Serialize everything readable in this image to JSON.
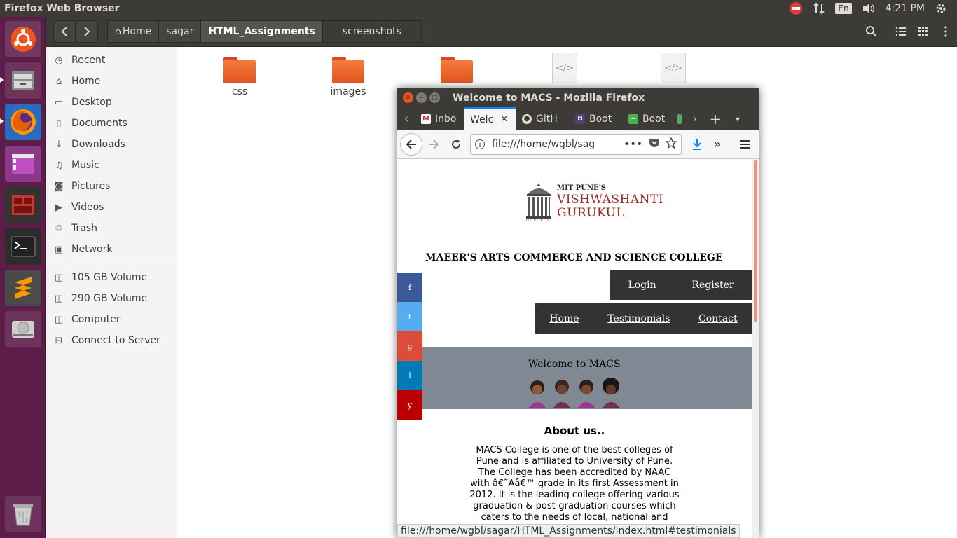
{
  "topbar": {
    "title": "Firefox Web Browser",
    "lang": "En",
    "time": "4:21 PM"
  },
  "launcher": {
    "items": [
      "ubuntu-dash",
      "files",
      "firefox",
      "image-viewer",
      "system-monitor",
      "terminal",
      "sublime-text",
      "disks",
      "trash"
    ]
  },
  "nautilus": {
    "breadcrumbs": [
      "Home",
      "sagar",
      "HTML_Assignments",
      "screenshots"
    ],
    "active_crumb": "HTML_Assignments",
    "sidebar": {
      "items": [
        {
          "label": "Recent",
          "icon": "clock-icon"
        },
        {
          "label": "Home",
          "icon": "home-icon"
        },
        {
          "label": "Desktop",
          "icon": "desktop-icon"
        },
        {
          "label": "Documents",
          "icon": "documents-icon"
        },
        {
          "label": "Downloads",
          "icon": "downloads-icon"
        },
        {
          "label": "Music",
          "icon": "music-icon"
        },
        {
          "label": "Pictures",
          "icon": "pictures-icon"
        },
        {
          "label": "Videos",
          "icon": "videos-icon"
        },
        {
          "label": "Trash",
          "icon": "trash-icon"
        },
        {
          "label": "Network",
          "icon": "network-icon"
        }
      ],
      "devices": [
        {
          "label": "105 GB Volume",
          "icon": "drive-icon"
        },
        {
          "label": "290 GB Volume",
          "icon": "drive-icon"
        },
        {
          "label": "Computer",
          "icon": "drive-icon"
        },
        {
          "label": "Connect to Server",
          "icon": "server-icon"
        }
      ]
    },
    "files": [
      {
        "name": "css",
        "type": "folder"
      },
      {
        "name": "images",
        "type": "folder"
      },
      {
        "name": "",
        "type": "folder"
      },
      {
        "name": "",
        "type": "html-file"
      },
      {
        "name": "",
        "type": "html-file"
      }
    ]
  },
  "firefox": {
    "title": "Welcome to MACS - Mozilla Firefox",
    "tabs": [
      {
        "label": "Inbo",
        "icon": "gmail-icon",
        "active": false
      },
      {
        "label": "Welc",
        "icon": "",
        "active": true
      },
      {
        "label": "GitH",
        "icon": "github-icon",
        "active": false
      },
      {
        "label": "Boot",
        "icon": "bootstrap-icon",
        "active": false
      },
      {
        "label": "Boot",
        "icon": "codepen-icon",
        "active": false
      }
    ],
    "url": "file:///home/wgbl/sag",
    "status_url": "file:///home/wgbl/sagar/HTML_Assignments/index.html#testimonials"
  },
  "page": {
    "logo_top": "MIT PUNE'S",
    "logo_line1": "VISHWASHANTI",
    "logo_line2": "GURUKUL",
    "logo_small": "GURUKUL",
    "college_name": "MAEER'S ARTS COMMERCE AND SCIENCE COLLEGE",
    "auth_links": [
      "Login",
      "Register"
    ],
    "nav_links": [
      "Home",
      "Testimonials",
      "Contact"
    ],
    "social": [
      {
        "letter": "f",
        "color": "#3b5998"
      },
      {
        "letter": "t",
        "color": "#55acee"
      },
      {
        "letter": "g",
        "color": "#dd4b39"
      },
      {
        "letter": "l",
        "color": "#007bb5"
      },
      {
        "letter": "y",
        "color": "#bb0000"
      }
    ],
    "banner_text": "Welcome to MACS",
    "about_heading": "About us..",
    "about_lines": [
      "MACS College is one of the best colleges of",
      "Pune and is affiliated to University of Pune.",
      "The College has been accredited by NAAC",
      "with â€˜Aâ€™ grade in its first Assessment in",
      "2012. It is the leading college offering various",
      "graduation & post-graduation courses which",
      "caters to the needs of local, national and"
    ]
  }
}
